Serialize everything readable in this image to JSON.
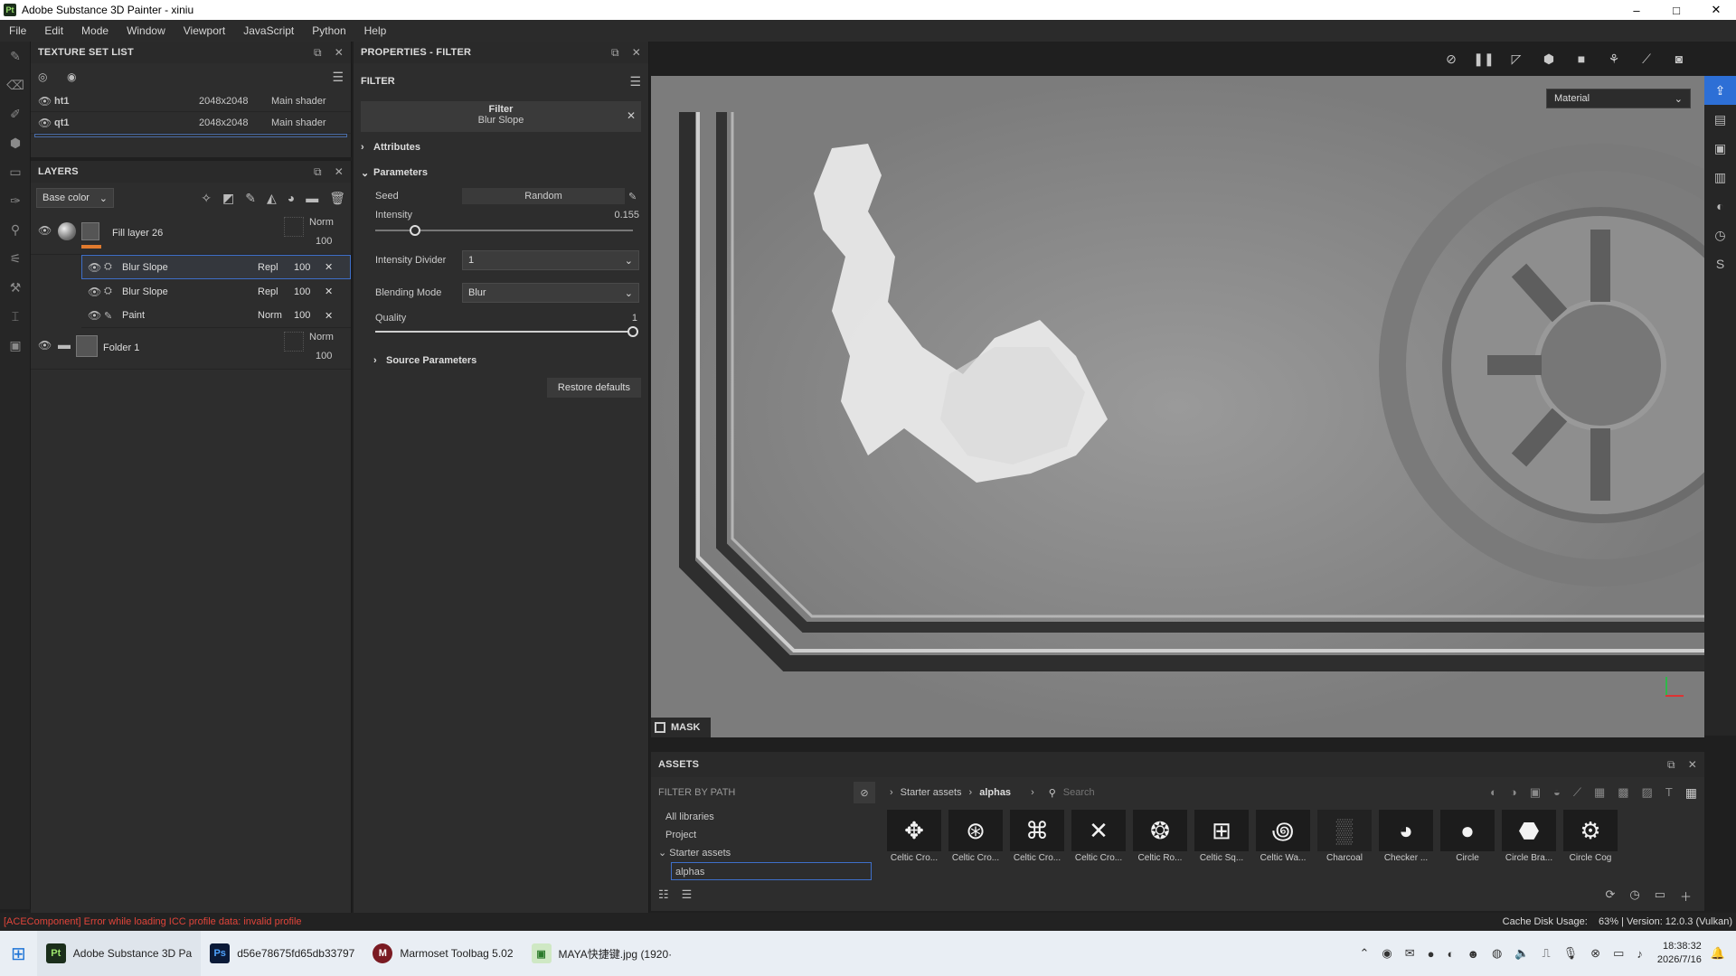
{
  "window": {
    "title": "Adobe Substance 3D Painter - xiniu",
    "logo": "Pt",
    "controls": [
      "–",
      "□",
      "✕"
    ]
  },
  "menu": [
    "File",
    "Edit",
    "Mode",
    "Window",
    "Viewport",
    "JavaScript",
    "Python",
    "Help"
  ],
  "texture_set_list": {
    "title": "TEXTURE SET LIST",
    "rows": [
      {
        "name": "ht1",
        "size": "2048x2048",
        "shader": "Main shader"
      },
      {
        "name": "qt1",
        "size": "2048x2048",
        "shader": "Main shader"
      }
    ]
  },
  "layers": {
    "title": "LAYERS",
    "channel": "Base color",
    "fill_layer": {
      "name": "Fill layer 26",
      "blend": "Norm",
      "opacity": "100"
    },
    "effects": [
      {
        "name": "Blur Slope",
        "blend": "Repl",
        "opacity": "100"
      },
      {
        "name": "Blur Slope",
        "blend": "Repl",
        "opacity": "100"
      },
      {
        "name": "Paint",
        "blend": "Norm",
        "opacity": "100"
      }
    ],
    "folder": {
      "name": "Folder 1",
      "blend": "Norm",
      "opacity": "100"
    }
  },
  "properties": {
    "title": "PROPERTIES - FILTER",
    "section": "FILTER",
    "filter_label": "Filter",
    "filter_name": "Blur Slope",
    "attributes": "Attributes",
    "parameters": "Parameters",
    "seed_label": "Seed",
    "seed_value": "Random",
    "intensity_label": "Intensity",
    "intensity_value": "0.155",
    "intensity_fraction": 0.155,
    "divider_label": "Intensity Divider",
    "divider_value": "1",
    "blend_label": "Blending Mode",
    "blend_value": "Blur",
    "quality_label": "Quality",
    "quality_value": "1",
    "quality_fraction": 1.0,
    "source_params": "Source Parameters",
    "restore": "Restore defaults"
  },
  "viewport": {
    "mode": "Material",
    "mask_label": "MASK"
  },
  "assets": {
    "title": "ASSETS",
    "filter_by_path": "FILTER BY PATH",
    "tree": [
      "All libraries",
      "Project",
      "Starter assets",
      "alphas"
    ],
    "breadcrumb": [
      "Starter assets",
      "alphas"
    ],
    "search_placeholder": "Search",
    "tiles": [
      "Celtic Cro...",
      "Celtic Cro...",
      "Celtic Cro...",
      "Celtic Cro...",
      "Celtic Ro...",
      "Celtic Sq...",
      "Celtic Wa...",
      "Charcoal",
      "Checker ...",
      "Circle",
      "Circle Bra...",
      "Circle Cog"
    ]
  },
  "status": {
    "error": "[ACEComponent] Error while loading ICC profile data: invalid profile",
    "right": "Cache Disk Usage:    63% | Version: 12.0.3 (Vulkan)"
  },
  "taskbar": {
    "apps": [
      {
        "label": "Adobe Substance 3D Pa",
        "icon": "Pt"
      },
      {
        "label": "d56e78675fd65db33797",
        "icon": "Ps"
      },
      {
        "label": "Marmoset Toolbag 5.02",
        "icon": "M"
      },
      {
        "label": "MAYA快捷键.jpg  (1920·",
        "icon": "▣"
      }
    ],
    "time": "18:38:32",
    "date": "2026/7/16"
  }
}
